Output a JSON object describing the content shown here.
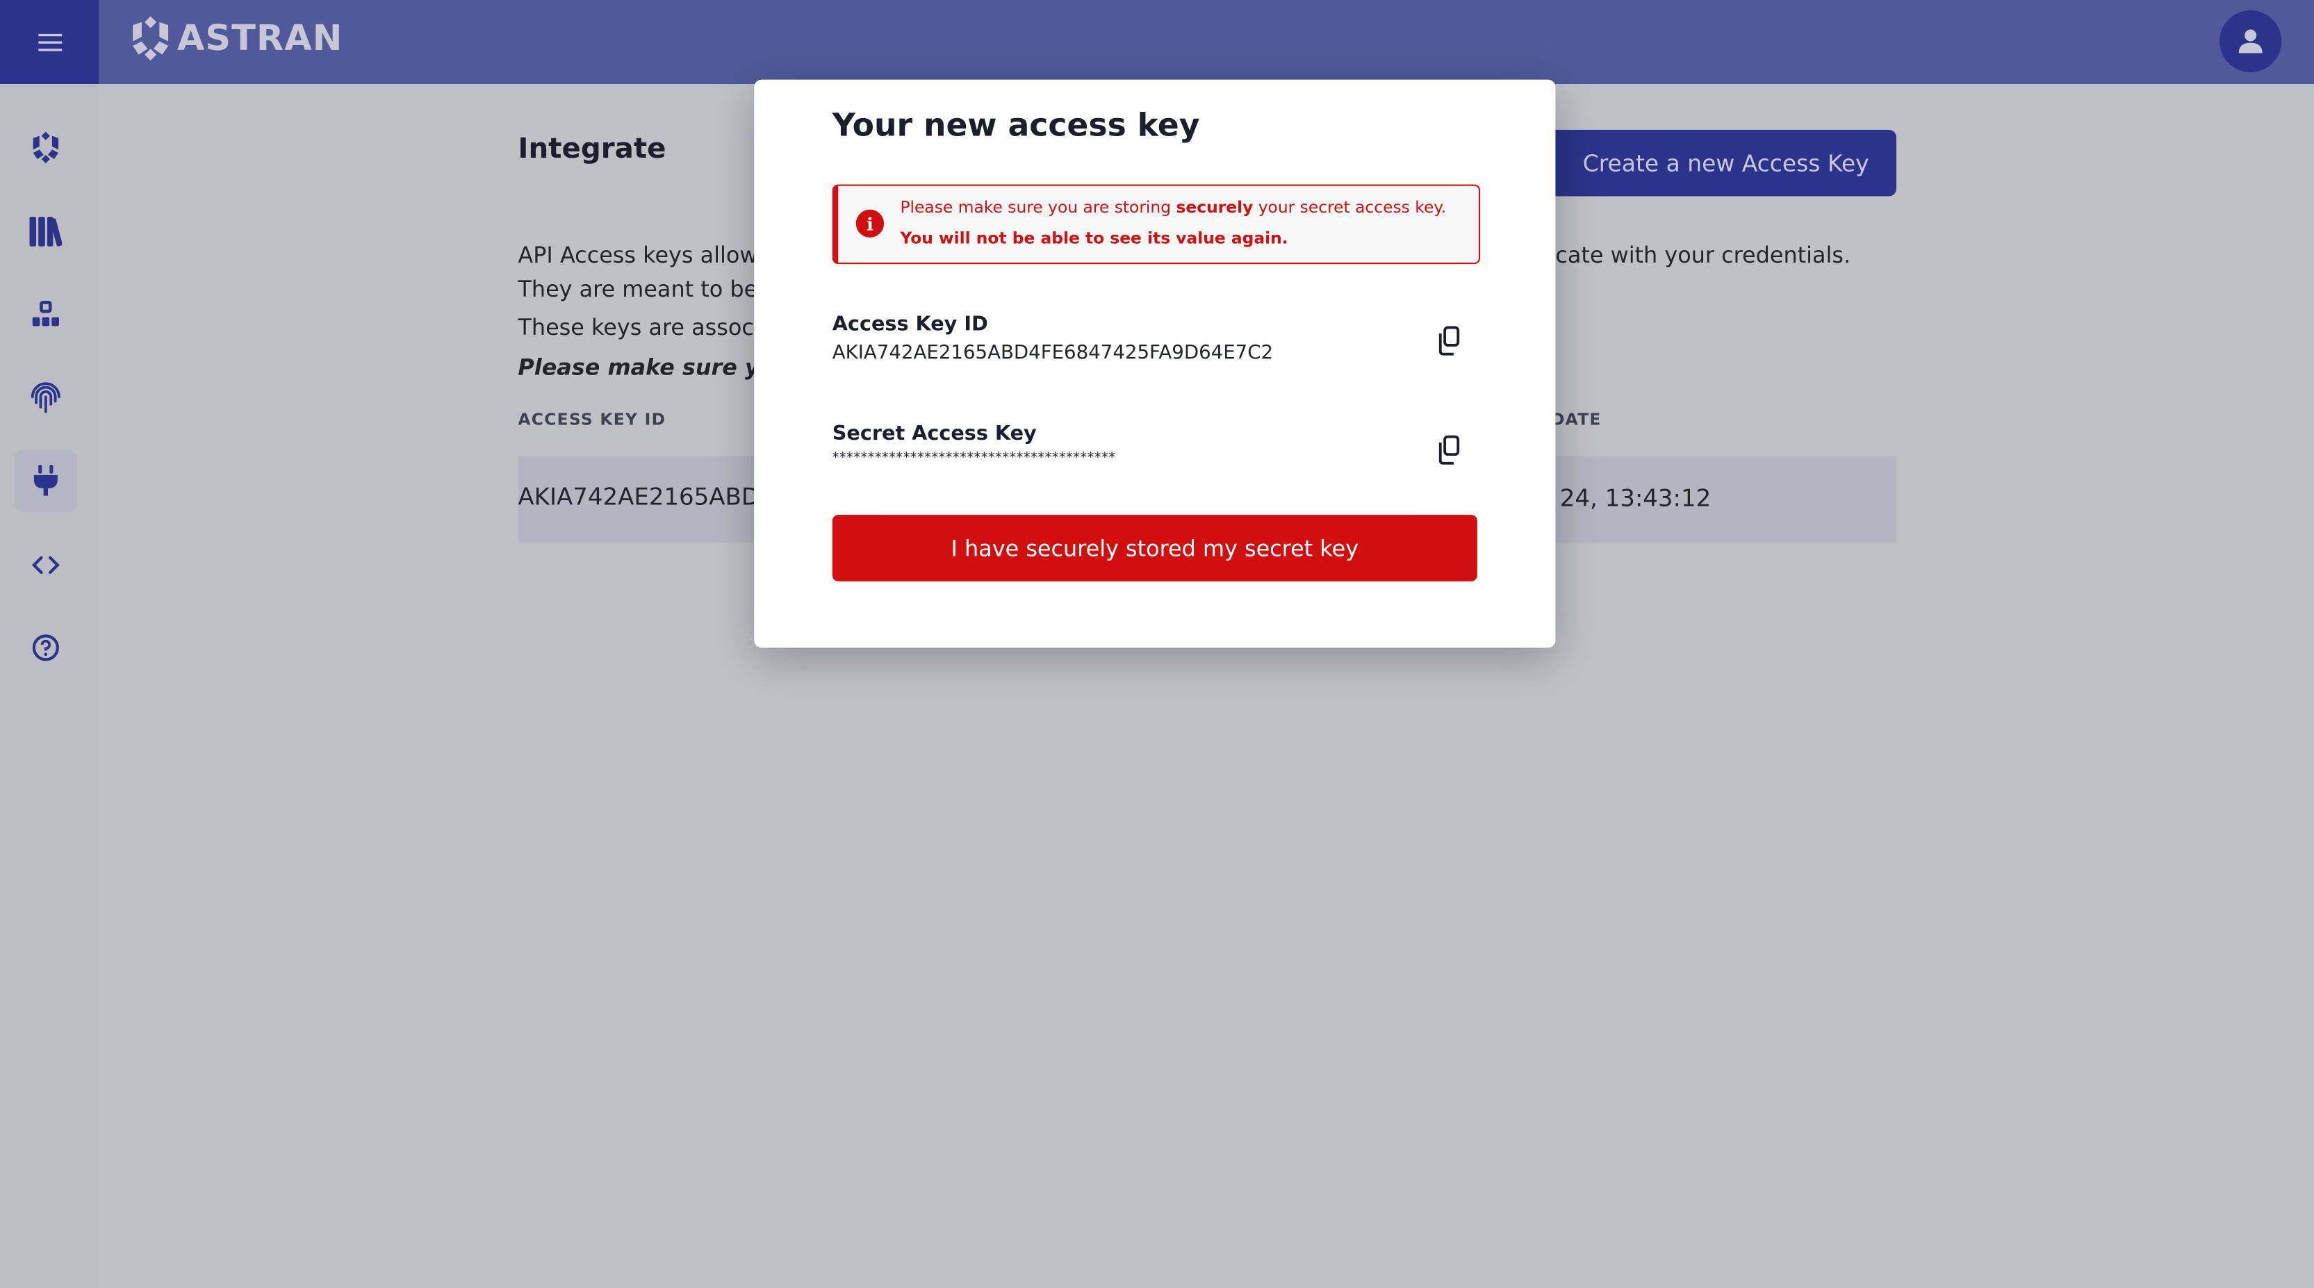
{
  "header": {
    "brand": "ASTRAN",
    "menu_icon": "hamburger-icon",
    "avatar_icon": "user-icon"
  },
  "colors": {
    "header": "#51599a",
    "accent": "#2b338a",
    "danger": "#d10f0f"
  },
  "sidebar": {
    "items": [
      {
        "icon": "astran-logo-icon",
        "active": false
      },
      {
        "icon": "library-icon",
        "active": false
      },
      {
        "icon": "hierarchy-icon",
        "active": false
      },
      {
        "icon": "fingerprint-icon",
        "active": false
      },
      {
        "icon": "plug-icon",
        "active": true
      },
      {
        "icon": "code-icon",
        "active": false
      },
      {
        "icon": "help-icon",
        "active": false
      }
    ]
  },
  "page": {
    "title": "Integrate",
    "create_button": "Create a new Access Key",
    "desc_line1_left": "API Access keys allow",
    "desc_line1_right": "cate with your credentials.",
    "desc_line2_left": "They are meant to be",
    "desc_line3_left": "These keys are associ",
    "desc_line4_left": "Please make sure yo",
    "table": {
      "col_access_key_id": "ACCESS KEY ID",
      "col_date_fragment": "DATE",
      "rows": [
        {
          "access_key_id_fragment": "AKIA742AE2165ABD",
          "date_fragment": "24, 13:43:12"
        }
      ]
    }
  },
  "modal": {
    "title": "Your new access key",
    "alert_pre": "Please make sure you are storing ",
    "alert_bold": "securely",
    "alert_post": " your secret access key.",
    "alert_line2": "You will not be able to see its value again.",
    "access_key_label": "Access Key ID",
    "access_key_value": "AKIA742AE2165ABD4FE6847425FA9D64E7C2",
    "secret_label": "Secret Access Key",
    "secret_value": "****************************************",
    "confirm_button": "I have securely stored my secret key"
  }
}
